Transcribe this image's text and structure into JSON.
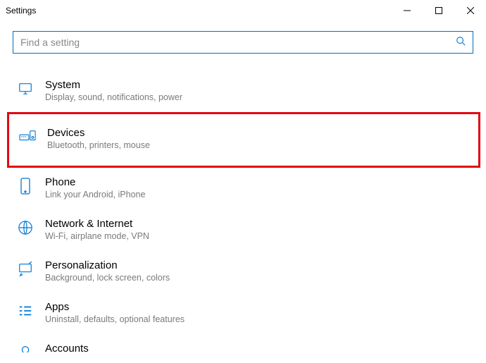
{
  "window": {
    "title": "Settings"
  },
  "search": {
    "placeholder": "Find a setting",
    "value": ""
  },
  "categories": [
    {
      "id": "system",
      "title": "System",
      "subtitle": "Display, sound, notifications, power",
      "icon": "system"
    },
    {
      "id": "devices",
      "title": "Devices",
      "subtitle": "Bluetooth, printers, mouse",
      "icon": "devices",
      "highlighted": true
    },
    {
      "id": "phone",
      "title": "Phone",
      "subtitle": "Link your Android, iPhone",
      "icon": "phone"
    },
    {
      "id": "network",
      "title": "Network & Internet",
      "subtitle": "Wi-Fi, airplane mode, VPN",
      "icon": "globe"
    },
    {
      "id": "personalization",
      "title": "Personalization",
      "subtitle": "Background, lock screen, colors",
      "icon": "brush"
    },
    {
      "id": "apps",
      "title": "Apps",
      "subtitle": "Uninstall, defaults, optional features",
      "icon": "apps"
    },
    {
      "id": "accounts",
      "title": "Accounts",
      "subtitle": "",
      "icon": "account",
      "partial": true
    }
  ],
  "accent_color": "#0078d4",
  "highlight_color": "#e30613"
}
